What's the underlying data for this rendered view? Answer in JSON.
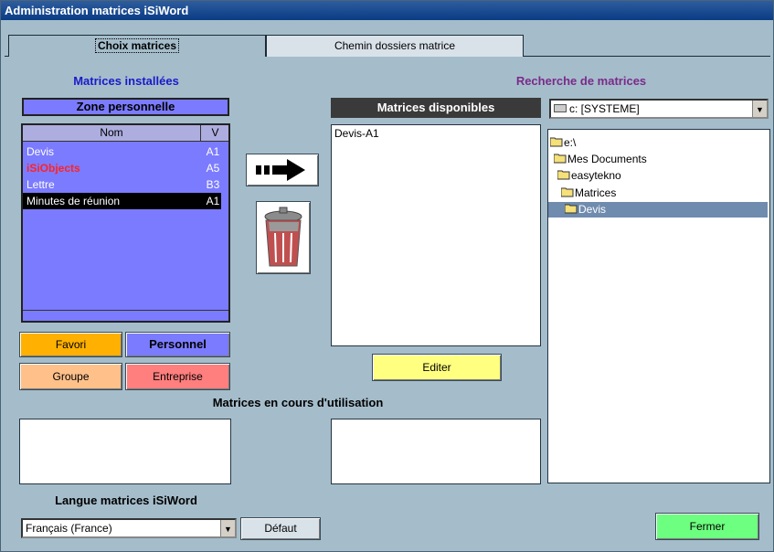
{
  "window": {
    "title": "Administration matrices iSiWord"
  },
  "tabs": [
    {
      "label": "Choix matrices",
      "active": true
    },
    {
      "label": "Chemin dossiers matrice",
      "active": false
    }
  ],
  "installed": {
    "heading": "Matrices installées",
    "zone": "Zone personnelle",
    "columns": {
      "name": "Nom",
      "version": "V"
    },
    "rows": [
      {
        "name": "Devis",
        "version": "A1"
      },
      {
        "name": "iSiObjects",
        "version": "A5"
      },
      {
        "name": "Lettre",
        "version": "B3"
      },
      {
        "name": "Minutes de réunion",
        "version": "A1"
      }
    ],
    "buttons": {
      "favori": "Favori",
      "personnel": "Personnel",
      "groupe": "Groupe",
      "entreprise": "Entreprise"
    }
  },
  "available": {
    "heading": "Matrices disponibles",
    "items": [
      "Devis-A1"
    ],
    "edit_button": "Editer"
  },
  "search": {
    "heading": "Recherche de matrices",
    "drive": "c: [SYSTEME]",
    "tree": [
      "e:\\",
      "Mes Documents",
      "easytekno",
      "Matrices",
      "Devis"
    ]
  },
  "in_use": {
    "heading": "Matrices en cours d'utilisation"
  },
  "language": {
    "heading": "Langue matrices iSiWord",
    "value": "Français (France)",
    "default_button": "Défaut"
  },
  "close_button": "Fermer",
  "colors": {
    "list_bg": "#7B7BFF",
    "favori": "#FFB000",
    "personnel": "#7B7BFF",
    "groupe": "#FFC08A",
    "entreprise": "#FF7E7E",
    "editer": "#FFFF80",
    "fermer": "#6DFF80",
    "search_heading": "#7A2A8A",
    "installed_heading": "#1A1AC8",
    "highlight_row": "#FF2222"
  }
}
